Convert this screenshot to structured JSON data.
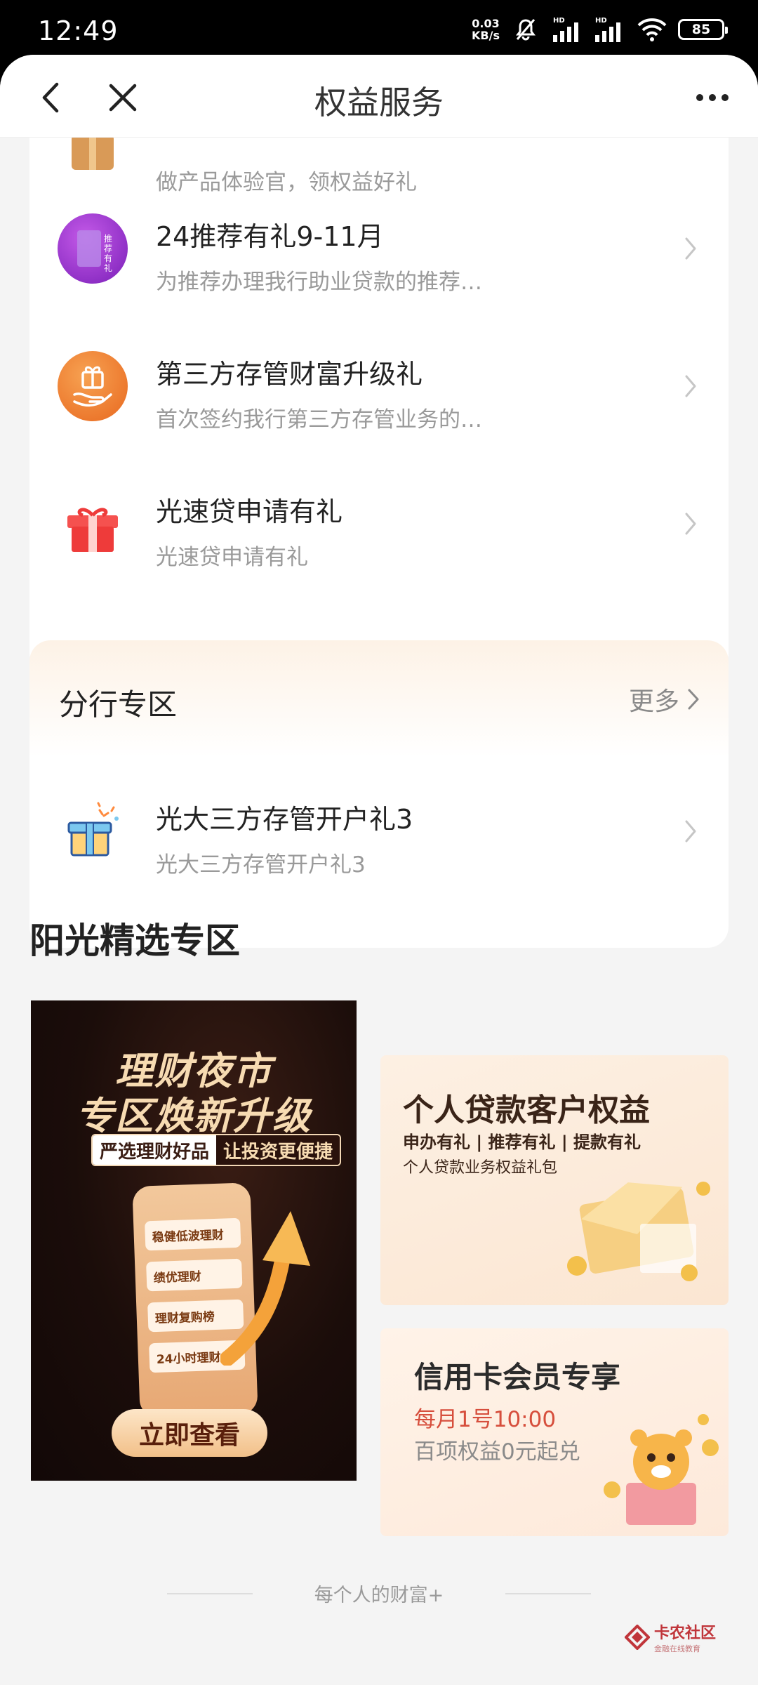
{
  "status_bar": {
    "time": "12:49",
    "net_speed_value": "0.03",
    "net_speed_unit": "KB/s",
    "signal_label_1": "HD",
    "signal_label_2": "HD",
    "battery": "85"
  },
  "header": {
    "title": "权益服务"
  },
  "benefits_list": [
    {
      "title": "",
      "desc": "做产品体验官，领权益好礼",
      "icon": "gift-box-icon"
    },
    {
      "title": "24推荐有礼9-11月",
      "desc": "为推荐办理我行助业贷款的推荐…",
      "icon": "recommend-gift-icon",
      "icon_text": "推荐有礼"
    },
    {
      "title": "第三方存管财富升级礼",
      "desc": "首次签约我行第三方存管业务的…",
      "icon": "hand-gift-icon"
    },
    {
      "title": "光速贷申请有礼",
      "desc": "光速贷申请有礼",
      "icon": "red-gift-box-icon"
    }
  ],
  "branch_zone": {
    "title": "分行专区",
    "more_label": "更多",
    "items": [
      {
        "title": "光大三方存管开户礼3",
        "desc": "光大三方存管开户礼3",
        "icon": "blue-gift-icon"
      }
    ]
  },
  "sunshine_zone": {
    "title": "阳光精选专区",
    "banner_left": {
      "title_line1": "理财夜市",
      "title_line2": "专区焕新升级",
      "tag_left": "严选理财好品",
      "tag_right": "让投资更便捷",
      "phone_items": [
        "稳健低波理财",
        "绩优理财",
        "理财复购榜",
        "24小时理财"
      ],
      "button": "立即查看"
    },
    "banner_right_top": {
      "title": "个人贷款客户权益",
      "subtitle": "申办有礼 | 推荐有礼 | 提款有礼",
      "subtitle2": "个人贷款业务权益礼包"
    },
    "banner_right_bottom": {
      "title": "信用卡会员专享",
      "line1": "每月1号10:00",
      "line2": "百项权益0元起兑"
    }
  },
  "footer": {
    "slogan": "每个人的财富+"
  },
  "watermark": {
    "main": "卡农社区",
    "sub": "金融在线教育"
  },
  "colors": {
    "accent_orange": "#e8681f",
    "purple": "#8f2fd0",
    "coupon_red": "#d64e3c"
  }
}
